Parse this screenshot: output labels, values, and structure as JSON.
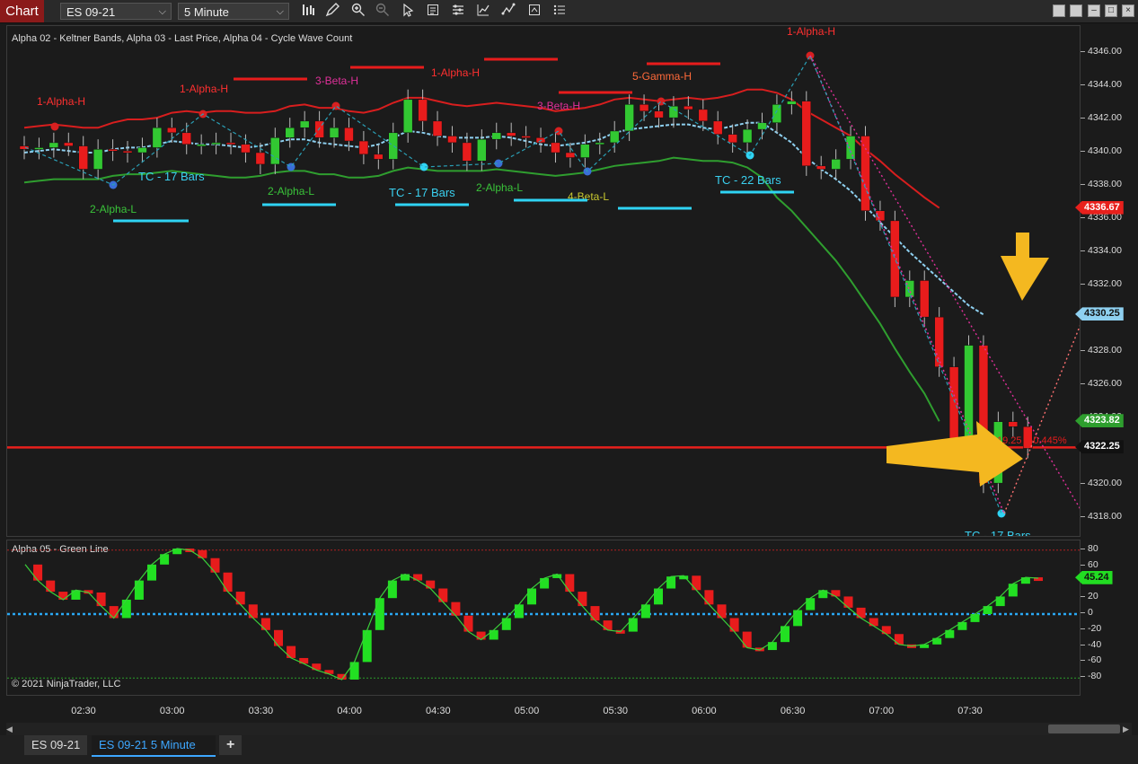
{
  "toolbar": {
    "chart_label": "Chart",
    "instrument": "ES 09-21",
    "interval": "5 Minute",
    "icons": [
      "bar-style-icon",
      "draw-pencil-icon",
      "zoom-in-icon",
      "zoom-out-icon",
      "pointer-icon",
      "data-box-icon",
      "properties-icon",
      "indicators-icon",
      "strategies-icon",
      "templates-icon",
      "more-menu-icon"
    ]
  },
  "main_panel": {
    "title": "Alpha 02 - Keltner Bands, Alpha 03 - Last Price, Alpha 04 - Cycle Wave Count",
    "annotations": [
      {
        "text": "1-Alpha-H",
        "color": "#ff3030"
      },
      {
        "text": "1-Alpha-H",
        "color": "#ff3030"
      },
      {
        "text": "3-Beta-H",
        "color": "#e0309a"
      },
      {
        "text": "1-Alpha-H",
        "color": "#ff3030"
      },
      {
        "text": "3-Beta-H",
        "color": "#e0309a"
      },
      {
        "text": "5-Gamma-H",
        "color": "#ff6a3a"
      },
      {
        "text": "1-Alpha-H",
        "color": "#ff3030"
      },
      {
        "text": "2-Alpha-L",
        "color": "#3ac43a"
      },
      {
        "text": "2-Alpha-L",
        "color": "#3ac43a"
      },
      {
        "text": "2-Alpha-L",
        "color": "#3ac43a"
      },
      {
        "text": "4-Beta-L",
        "color": "#c8c830"
      },
      {
        "text": "TC - 17 Bars",
        "color": "#3ad0f0"
      },
      {
        "text": "TC - 17 Bars",
        "color": "#3ad0f0"
      },
      {
        "text": "TC - 22 Bars",
        "color": "#3ad0f0"
      },
      {
        "text": "TC - 17 Bars",
        "color": "#3ad0f0"
      }
    ],
    "last_price_label": "19.25 / -0.445%"
  },
  "price_axis": {
    "ticks": [
      "4346.00",
      "4344.00",
      "4342.00",
      "4340.00",
      "4338.00",
      "4336.00",
      "4334.00",
      "4332.00",
      "4330.00",
      "4328.00",
      "4326.00",
      "4324.00",
      "4322.00",
      "4320.00",
      "4318.00"
    ],
    "flags": [
      {
        "text": "4336.67",
        "bg": "#e8201c",
        "fg": "#ffffff"
      },
      {
        "text": "4330.25",
        "bg": "#8ed0f0",
        "fg": "#111111"
      },
      {
        "text": "4323.82",
        "bg": "#2e9e2e",
        "fg": "#ffffff"
      },
      {
        "text": "4322.25",
        "bg": "#111111",
        "fg": "#ffffff"
      }
    ]
  },
  "sub_panel": {
    "title": "Alpha 05 - Green Line",
    "copyright": "© 2021 NinjaTrader, LLC",
    "ticks": [
      "80",
      "60",
      "40",
      "20",
      "0",
      "-20",
      "-40",
      "-60",
      "-80"
    ],
    "flag": {
      "text": "45.24",
      "bg": "#22dd22",
      "fg": "#111111"
    }
  },
  "time_axis": {
    "ticks": [
      "02:30",
      "03:00",
      "03:30",
      "04:00",
      "04:30",
      "05:00",
      "05:30",
      "06:00",
      "06:30",
      "07:00",
      "07:30"
    ]
  },
  "bottom_tabs": {
    "tab1": "ES 09-21",
    "tab2": "ES 09-21 5 Minute",
    "add": "+"
  },
  "chart_data": {
    "type": "candlestick",
    "instrument": "ES 09-21",
    "interval": "5 Minute",
    "ylim": [
      4317,
      4347
    ],
    "x": [
      "02:20",
      "02:25",
      "02:30",
      "02:35",
      "02:40",
      "02:45",
      "02:50",
      "02:55",
      "03:00",
      "03:05",
      "03:10",
      "03:15",
      "03:20",
      "03:25",
      "03:30",
      "03:35",
      "03:40",
      "03:45",
      "03:50",
      "03:55",
      "04:00",
      "04:05",
      "04:10",
      "04:15",
      "04:20",
      "04:25",
      "04:30",
      "04:35",
      "04:40",
      "04:45",
      "04:50",
      "04:55",
      "05:00",
      "05:05",
      "05:10",
      "05:15",
      "05:20",
      "05:25",
      "05:30",
      "05:35",
      "05:40",
      "05:45",
      "05:50",
      "05:55",
      "06:00",
      "06:05",
      "06:10",
      "06:15",
      "06:20",
      "06:25",
      "06:30",
      "06:35",
      "06:40",
      "06:45",
      "06:50",
      "06:55",
      "07:00",
      "07:05",
      "07:10",
      "07:15",
      "07:20",
      "07:25",
      "07:30",
      "07:35",
      "07:40",
      "07:45"
    ],
    "open": [
      4340.4,
      4340.2,
      4340.3,
      4340.6,
      4340.4,
      4339.0,
      4340.2,
      4340.1,
      4340.0,
      4340.3,
      4341.5,
      4341.2,
      4340.5,
      4340.5,
      4340.6,
      4340.5,
      4340.0,
      4339.3,
      4340.9,
      4341.5,
      4341.9,
      4340.9,
      4341.5,
      4340.7,
      4339.9,
      4339.6,
      4341.2,
      4343.2,
      4341.9,
      4341.0,
      4340.6,
      4339.5,
      4340.8,
      4341.2,
      4341.0,
      4340.9,
      4340.6,
      4340.0,
      4339.7,
      4340.5,
      4340.6,
      4341.3,
      4342.9,
      4342.5,
      4342.1,
      4342.8,
      4342.6,
      4341.9,
      4341.1,
      4340.6,
      4341.4,
      4341.8,
      4342.9,
      4343.1,
      4339.2,
      4339.0,
      4339.6,
      4341.0,
      4336.5,
      4335.9,
      4331.3,
      4332.3,
      4330.1,
      4327.1,
      4322.6,
      4328.4,
      4320.1,
      4323.8,
      4323.5
    ],
    "close": [
      4340.2,
      4340.3,
      4340.6,
      4340.4,
      4339.0,
      4340.2,
      4340.1,
      4340.0,
      4340.3,
      4341.5,
      4341.2,
      4340.5,
      4340.5,
      4340.6,
      4340.5,
      4340.0,
      4339.3,
      4340.9,
      4341.5,
      4341.9,
      4340.9,
      4341.5,
      4340.7,
      4339.9,
      4339.6,
      4341.2,
      4343.2,
      4341.9,
      4341.0,
      4340.6,
      4339.5,
      4340.8,
      4341.2,
      4341.0,
      4340.9,
      4340.6,
      4340.0,
      4339.7,
      4340.5,
      4340.6,
      4341.3,
      4342.9,
      4342.5,
      4342.1,
      4342.8,
      4342.6,
      4341.9,
      4341.1,
      4340.6,
      4341.4,
      4341.8,
      4342.9,
      4343.1,
      4339.2,
      4339.0,
      4339.6,
      4341.0,
      4336.5,
      4335.9,
      4331.3,
      4332.3,
      4330.1,
      4327.1,
      4322.6,
      4328.4,
      4320.1,
      4323.8,
      4323.5,
      4322.2
    ],
    "keltner_upper": [
      4341.5,
      4341.6,
      4341.7,
      4341.6,
      4341.5,
      4341.5,
      4341.8,
      4342.0,
      4342.0,
      4342.1,
      4342.4,
      4342.5,
      4342.4,
      4342.5,
      4342.5,
      4342.4,
      4342.4,
      4342.5,
      4342.8,
      4342.9,
      4342.7,
      4342.7,
      4342.5,
      4342.4,
      4342.6,
      4343.0,
      4343.3,
      4343.3,
      4343.1,
      4342.9,
      4342.8,
      4342.9,
      4343.0,
      4342.9,
      4342.8,
      4342.7,
      4342.5,
      4342.6,
      4342.7,
      4342.9,
      4343.2,
      4343.3,
      4343.2,
      4343.1,
      4343.2,
      4343.3,
      4343.2,
      4343.3,
      4343.5,
      4343.8,
      4343.8,
      4343.6,
      4343.2,
      4342.5,
      4342.0,
      4341.5,
      4341.0,
      4340.2,
      4339.5,
      4338.7,
      4338.0,
      4337.3,
      4336.67
    ],
    "keltner_mid": [
      4340.0,
      4340.1,
      4340.2,
      4340.1,
      4340.0,
      4340.0,
      4340.2,
      4340.3,
      4340.3,
      4340.5,
      4340.7,
      4340.6,
      4340.5,
      4340.5,
      4340.4,
      4340.3,
      4340.4,
      4340.6,
      4340.8,
      4340.8,
      4340.6,
      4340.5,
      4340.4,
      4340.3,
      4340.5,
      4340.9,
      4341.3,
      4341.2,
      4341.0,
      4340.9,
      4340.9,
      4340.9,
      4341.0,
      4340.9,
      4340.7,
      4340.5,
      4340.4,
      4340.5,
      4340.6,
      4340.8,
      4341.2,
      4341.4,
      4341.5,
      4341.6,
      4341.7,
      4341.7,
      4341.5,
      4341.4,
      4341.6,
      4341.8,
      4341.8,
      4341.2,
      4340.6,
      4339.7,
      4339.0,
      4338.4,
      4337.7,
      4336.8,
      4335.8,
      4334.9,
      4334.0,
      4333.2,
      4332.4,
      4331.6,
      4330.8,
      4330.25
    ],
    "keltner_lower": [
      4338.2,
      4338.3,
      4338.4,
      4338.4,
      4338.4,
      4338.4,
      4338.6,
      4338.7,
      4338.7,
      4338.8,
      4338.9,
      4338.8,
      4338.7,
      4338.6,
      4338.5,
      4338.5,
      4338.6,
      4338.8,
      4338.9,
      4338.9,
      4338.7,
      4338.7,
      4338.5,
      4338.5,
      4338.6,
      4338.9,
      4339.1,
      4339.0,
      4338.9,
      4338.9,
      4338.9,
      4338.9,
      4339.0,
      4338.9,
      4338.8,
      4338.7,
      4338.6,
      4338.7,
      4338.8,
      4339.0,
      4339.2,
      4339.3,
      4339.4,
      4339.5,
      4339.7,
      4339.6,
      4339.5,
      4339.5,
      4339.4,
      4339.1,
      4338.5,
      4337.3,
      4336.5,
      4335.5,
      4334.5,
      4333.5,
      4332.3,
      4331.0,
      4329.7,
      4328.2,
      4326.8,
      4325.5,
      4323.82
    ],
    "last_price": 4322.25,
    "oscillator": {
      "name": "Alpha 05 - Green Line",
      "ylim": [
        -95,
        95
      ],
      "last": 45.24,
      "values": [
        62,
        42,
        28,
        18,
        30,
        27,
        10,
        -5,
        18,
        42,
        62,
        75,
        82,
        80,
        70,
        52,
        28,
        12,
        -5,
        -20,
        -40,
        -55,
        -62,
        -70,
        -75,
        -82,
        -60,
        -20,
        20,
        42,
        50,
        42,
        32,
        15,
        -2,
        -22,
        -32,
        -20,
        -5,
        12,
        32,
        45,
        50,
        28,
        10,
        -8,
        -20,
        -22,
        -5,
        12,
        32,
        47,
        48,
        30,
        12,
        -5,
        -22,
        -42,
        -45,
        -35,
        -15,
        5,
        20,
        30,
        22,
        8,
        -5,
        -15,
        -25,
        -38,
        -40,
        -38,
        -30,
        -20,
        -10,
        0,
        10,
        22,
        38,
        46,
        45
      ]
    }
  }
}
